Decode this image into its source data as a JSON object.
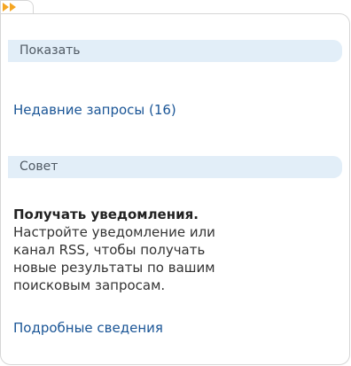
{
  "tab": {
    "icon": "double-right-arrow-icon",
    "accent_color": "#f5a623"
  },
  "show_section": {
    "header": "Показать",
    "recent_queries_link": "Недавние запросы (16)"
  },
  "tip_section": {
    "header": "Совет",
    "title": "Получать уведомления.",
    "body_lines": [
      "Настройте уведомление или",
      "канал RSS, чтобы получать",
      "новые результаты по вашим",
      "поисковым запросам."
    ],
    "details_link": "Подробные сведения"
  },
  "colors": {
    "header_bg": "#e2eef8",
    "link": "#1a5596",
    "border": "#d6d6d6"
  }
}
